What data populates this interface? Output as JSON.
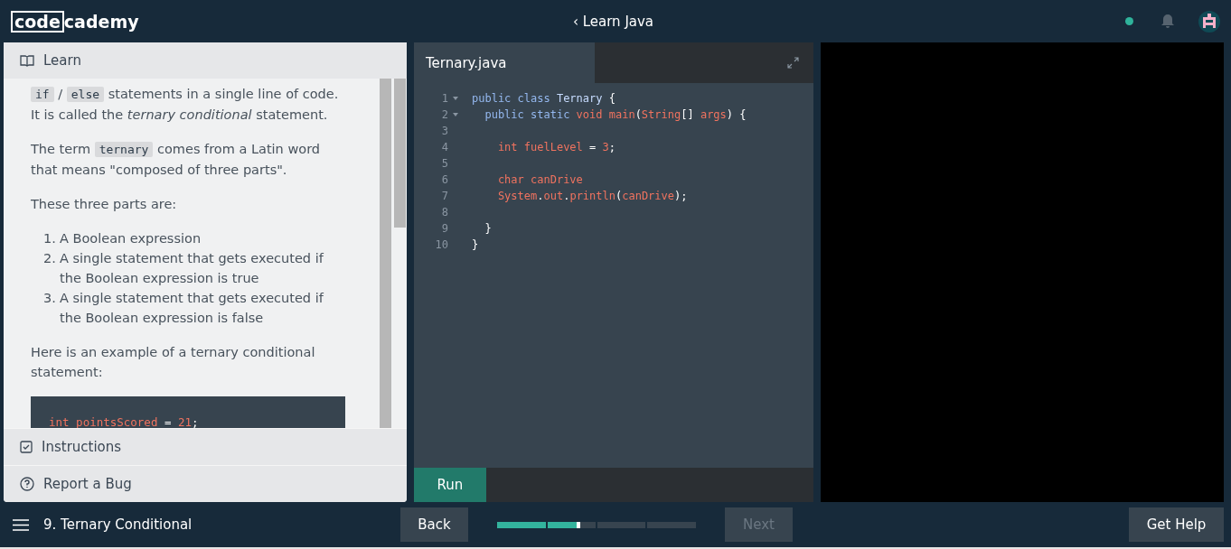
{
  "header": {
    "logo_boxed": "code",
    "logo_rest": "cademy",
    "course": "Learn Java",
    "back_glyph": "‹"
  },
  "lesson": {
    "title": "Learn",
    "blocks": [
      {
        "kind": "para",
        "segments": [
          {
            "kind": "code",
            "text": "if"
          },
          {
            "kind": "text",
            "text": " / "
          },
          {
            "kind": "code",
            "text": "else"
          },
          {
            "kind": "text",
            "text": " statements in a single line of code. It is called the "
          },
          {
            "kind": "italic",
            "text": "ternary conditional"
          },
          {
            "kind": "text",
            "text": " statement."
          }
        ]
      },
      {
        "kind": "para",
        "segments": [
          {
            "kind": "text",
            "text": "The term "
          },
          {
            "kind": "code",
            "text": "ternary"
          },
          {
            "kind": "text",
            "text": " comes from a Latin word that means \"composed of three parts\"."
          }
        ]
      },
      {
        "kind": "para",
        "segments": [
          {
            "kind": "text",
            "text": "These three parts are:"
          }
        ]
      },
      {
        "kind": "list",
        "items": [
          {
            "num": "1.",
            "text": "A Boolean expression"
          },
          {
            "num": "2.",
            "text": "A single statement that gets executed if the Boolean expression is true"
          },
          {
            "num": "3.",
            "text": "A single statement that gets executed if the Boolean expression is false"
          }
        ]
      },
      {
        "kind": "para",
        "segments": [
          {
            "kind": "text",
            "text": "Here is an example of a ternary conditional statement:"
          }
        ]
      },
      {
        "kind": "code",
        "tokens": [
          {
            "kind": "id",
            "text": "int pointsScored"
          },
          {
            "kind": "punct",
            "text": " = "
          },
          {
            "kind": "id",
            "text": "21"
          },
          {
            "kind": "punct",
            "text": ";"
          }
        ]
      }
    ],
    "footer_items": [
      {
        "kind": "checkbox",
        "label": "Instructions"
      },
      {
        "kind": "help",
        "label": "Report a Bug"
      }
    ]
  },
  "editor": {
    "tab": "Ternary.java",
    "lines": [
      {
        "num": "1",
        "fold": true,
        "tokens": [
          {
            "kind": "kw",
            "text": "public class "
          },
          {
            "kind": "type",
            "text": "Ternary"
          },
          {
            "kind": "punct",
            "text": " {"
          }
        ]
      },
      {
        "num": "2",
        "fold": true,
        "tokens": [
          {
            "kind": "kw",
            "text": "  public static "
          },
          {
            "kind": "id",
            "text": "void main"
          },
          {
            "kind": "punct",
            "text": "("
          },
          {
            "kind": "id",
            "text": "String"
          },
          {
            "kind": "punct",
            "text": "[] "
          },
          {
            "kind": "id",
            "text": "args"
          },
          {
            "kind": "punct",
            "text": ") {"
          }
        ]
      },
      {
        "num": "3",
        "fold": false
      },
      {
        "num": "4",
        "fold": false,
        "tokens": [
          {
            "kind": "id",
            "text": "    int fuelLevel"
          },
          {
            "kind": "punct",
            "text": " = "
          },
          {
            "kind": "id",
            "text": "3"
          },
          {
            "kind": "punct",
            "text": ";"
          }
        ]
      },
      {
        "num": "5",
        "fold": false
      },
      {
        "num": "6",
        "fold": false,
        "tokens": [
          {
            "kind": "id",
            "text": "    char canDrive"
          }
        ]
      },
      {
        "num": "7",
        "fold": false,
        "tokens": [
          {
            "kind": "id",
            "text": "    System"
          },
          {
            "kind": "punct",
            "text": "."
          },
          {
            "kind": "id",
            "text": "out"
          },
          {
            "kind": "punct",
            "text": "."
          },
          {
            "kind": "id",
            "text": "println"
          },
          {
            "kind": "punct",
            "text": "("
          },
          {
            "kind": "id",
            "text": "canDrive"
          },
          {
            "kind": "punct",
            "text": ");"
          }
        ]
      },
      {
        "num": "8",
        "fold": false
      },
      {
        "num": "9",
        "fold": false,
        "tokens": [
          {
            "kind": "punct",
            "text": "  }"
          }
        ]
      },
      {
        "num": "10",
        "fold": false,
        "tokens": [
          {
            "kind": "punct",
            "text": "}"
          }
        ]
      }
    ],
    "run": "Run"
  },
  "footer": {
    "lesson": "9. Ternary Conditional",
    "back": "Back",
    "next": "Next",
    "next_disabled": true,
    "progress": {
      "level": 0.42
    },
    "help": "Get Help"
  }
}
